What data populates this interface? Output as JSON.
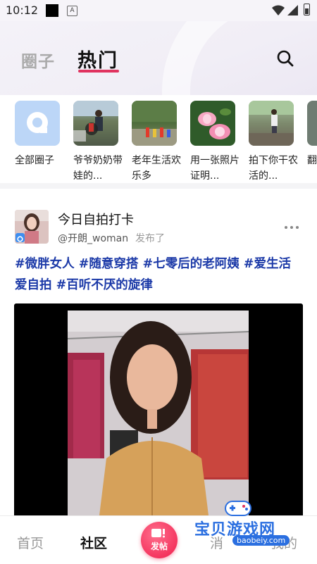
{
  "status_bar": {
    "time": "10:12",
    "app_icon": "a-icon",
    "icons": [
      "wifi-icon",
      "signal-icon",
      "battery-icon"
    ]
  },
  "header": {
    "tabs": [
      {
        "label": "圈子",
        "active": false
      },
      {
        "label": "热门",
        "active": true
      }
    ],
    "accent_color": "#e0335f",
    "search_icon": "search-icon"
  },
  "circles": [
    {
      "label": "全部圈子"
    },
    {
      "label": "爷爷奶奶带娃的..."
    },
    {
      "label": "老年生活欢乐多"
    },
    {
      "label": "用一张照片证明..."
    },
    {
      "label": "拍下你干农活的..."
    },
    {
      "label": "翻老..."
    }
  ],
  "post": {
    "title": "今日自拍打卡",
    "username": "@开朗_woman",
    "action": "发布了",
    "tags": [
      "#微胖女人",
      "#随意穿搭",
      "#七零后的老阿姨",
      "#爱生活",
      "爱自拍",
      "#百听不厌的旋律"
    ],
    "tag_color": "#1c3aa8"
  },
  "bottom_nav": {
    "home": "首页",
    "community": "社区",
    "post_button": "发帖",
    "messages": "消",
    "mine": "我的"
  },
  "watermark": {
    "text": "宝贝游戏网",
    "url": "baobeiy.com"
  }
}
